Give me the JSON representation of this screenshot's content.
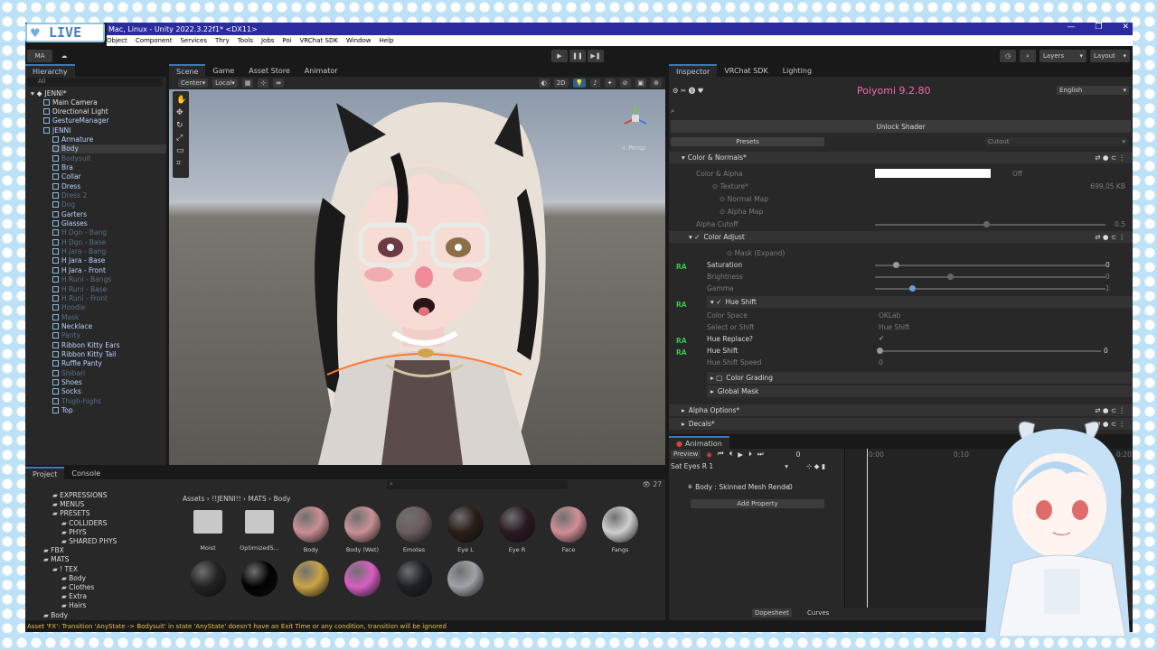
{
  "stream": {
    "badge": "LIVE"
  },
  "window": {
    "title": "Mac, Linux - Unity 2022.3.22f1* <DX11>",
    "controls": [
      "—",
      "❐",
      "✕"
    ]
  },
  "menu": [
    "Object",
    "Component",
    "Services",
    "Thry",
    "Tools",
    "Jobs",
    "Poi",
    "VRChat SDK",
    "Window",
    "Help"
  ],
  "toolbar": {
    "account": "MA",
    "layers": "Layers",
    "layout": "Layout"
  },
  "hierarchy": {
    "tab": "Hierarchy",
    "search": "All",
    "root": "JENNI*",
    "items": [
      {
        "label": "Main Camera",
        "style": "white",
        "indent": 1
      },
      {
        "label": "Directional Light",
        "style": "white",
        "indent": 1
      },
      {
        "label": "GestureManager",
        "style": "blue",
        "indent": 1
      },
      {
        "label": "JENNI",
        "style": "blue",
        "indent": 1
      },
      {
        "label": "Armature",
        "style": "blue",
        "indent": 2
      },
      {
        "label": "Body",
        "style": "sel",
        "indent": 2
      },
      {
        "label": "Bodysuit",
        "style": "dim",
        "indent": 2
      },
      {
        "label": "Bra",
        "style": "blue",
        "indent": 2
      },
      {
        "label": "Collar",
        "style": "blue",
        "indent": 2
      },
      {
        "label": "Dress",
        "style": "blue",
        "indent": 2
      },
      {
        "label": "Dress 2",
        "style": "dim",
        "indent": 2
      },
      {
        "label": "Dog",
        "style": "dim",
        "indent": 2
      },
      {
        "label": "Garters",
        "style": "blue",
        "indent": 2
      },
      {
        "label": "Glasses",
        "style": "blue",
        "indent": 2
      },
      {
        "label": "H Dgn - Bang",
        "style": "dim",
        "indent": 2
      },
      {
        "label": "H Dgn - Base",
        "style": "dim",
        "indent": 2
      },
      {
        "label": "H Jara - Bang",
        "style": "dim",
        "indent": 2
      },
      {
        "label": "H Jara - Base",
        "style": "blue",
        "indent": 2
      },
      {
        "label": "H Jara - Front",
        "style": "blue",
        "indent": 2
      },
      {
        "label": "H Runi - Bangs",
        "style": "dim",
        "indent": 2
      },
      {
        "label": "H Runi - Base",
        "style": "dim",
        "indent": 2
      },
      {
        "label": "H Runi - Front",
        "style": "dim",
        "indent": 2
      },
      {
        "label": "Hoodie",
        "style": "dim",
        "indent": 2
      },
      {
        "label": "Mask",
        "style": "dim",
        "indent": 2
      },
      {
        "label": "Necklace",
        "style": "blue",
        "indent": 2
      },
      {
        "label": "Panty",
        "style": "dim",
        "indent": 2
      },
      {
        "label": "Ribbon Kitty Ears",
        "style": "blue",
        "indent": 2
      },
      {
        "label": "Ribbon Kitty Tail",
        "style": "blue",
        "indent": 2
      },
      {
        "label": "Ruffle Panty",
        "style": "blue",
        "indent": 2
      },
      {
        "label": "Shibari",
        "style": "dim",
        "indent": 2
      },
      {
        "label": "Shoes",
        "style": "blue",
        "indent": 2
      },
      {
        "label": "Socks",
        "style": "blue",
        "indent": 2
      },
      {
        "label": "Thigh-highs",
        "style": "dim",
        "indent": 2
      },
      {
        "label": "Top",
        "style": "blue",
        "indent": 2
      }
    ]
  },
  "scene": {
    "tabs": [
      "Scene",
      "Game",
      "Asset Store",
      "Animator"
    ],
    "pivot": "Center",
    "space": "Local",
    "mode2d": "2D",
    "persp": "< Persp"
  },
  "inspector": {
    "tabs": [
      "Inspector",
      "VRChat SDK",
      "Lighting"
    ],
    "shader": "Poiyomi 9.2.80",
    "language": "English",
    "unlock": "Unlock Shader",
    "presets": "Presets",
    "cutout": "Cutout",
    "sections": {
      "color_normals": "Color & Normals*",
      "color_alpha": "Color & Alpha",
      "off": "Off",
      "texture": "Texture*",
      "texture_size": "699.05 KB",
      "normal_map": "Normal Map",
      "alpha_map": "Alpha Map",
      "alpha_cutoff": "Alpha Cutoff",
      "alpha_cutoff_val": "0.5",
      "color_adjust": "Color Adjust",
      "mask": "Mask (Expand)",
      "saturation": "Saturation",
      "saturation_val": "0",
      "brightness": "Brightness",
      "brightness_val": "0",
      "gamma": "Gamma",
      "gamma_val": "1",
      "hue_shift_header": "Hue Shift",
      "color_space": "Color Space",
      "color_space_val": "OKLab",
      "select_shift": "Select or Shift",
      "select_shift_val": "Hue Shift",
      "hue_replace": "Hue Replace?",
      "hue_shift": "Hue Shift",
      "hue_shift_val": "0",
      "hue_shift_speed": "Hue Shift Speed",
      "hue_shift_speed_val": "0",
      "color_grading": "Color Grading",
      "global_mask": "Global Mask",
      "alpha_options": "Alpha Options*",
      "decals": "Decals*",
      "ra": "RA"
    }
  },
  "animation": {
    "tab": "Animation",
    "preview": "Preview",
    "frame": "0",
    "clip": "Sat Eyes R 1",
    "property": "Body : Skinned Mesh Rende",
    "property_val": "0",
    "add": "Add Property",
    "dopesheet": "Dopesheet",
    "curves": "Curves",
    "time_0": "0:00",
    "time_1": "0:10",
    "time_2": "0:20"
  },
  "project": {
    "tabs": [
      "Project",
      "Console"
    ],
    "breadcrumb": [
      "Assets",
      "!!JENNI!!",
      "MATS",
      "Body"
    ],
    "tree": [
      {
        "label": "EXPRESSIONS",
        "indent": 2
      },
      {
        "label": "MENUS",
        "indent": 2
      },
      {
        "label": "PRESETS",
        "indent": 2
      },
      {
        "label": "COLLIDERS",
        "indent": 3
      },
      {
        "label": "PHYS",
        "indent": 3
      },
      {
        "label": "SHARED PHYS",
        "indent": 3
      },
      {
        "label": "FBX",
        "indent": 1
      },
      {
        "label": "MATS",
        "indent": 1
      },
      {
        "label": "! TEX",
        "indent": 2
      },
      {
        "label": "Body",
        "indent": 3
      },
      {
        "label": "Clothes",
        "indent": 3
      },
      {
        "label": "Extra",
        "indent": 3
      },
      {
        "label": "Hairs",
        "indent": 3
      },
      {
        "label": "Body",
        "indent": 1
      }
    ],
    "assets": [
      {
        "label": "Moist",
        "kind": "folder"
      },
      {
        "label": "OptimizedS...",
        "kind": "folder"
      },
      {
        "label": "Body",
        "color": "#c98f94"
      },
      {
        "label": "Body (Wet)",
        "color": "#c99096"
      },
      {
        "label": "Emotes",
        "color": "#6a5c5c"
      },
      {
        "label": "Eye L",
        "color": "#2a1e18"
      },
      {
        "label": "Eye R",
        "color": "#2a1a22"
      },
      {
        "label": "Face",
        "color": "#d08f96"
      },
      {
        "label": "Fangs",
        "color": "#cfcfcf"
      },
      {
        "label": "",
        "color": "#222222"
      },
      {
        "label": "",
        "color": "#020202"
      },
      {
        "label": "",
        "color": "#c9a445"
      },
      {
        "label": "",
        "color": "#d85fc2"
      },
      {
        "label": "",
        "color": "#1c2128"
      },
      {
        "label": "",
        "color": "#9ea3a8"
      }
    ],
    "count": "27"
  },
  "status": "Asset 'FX': Transition 'AnyState -> Bodysuit' in state 'AnyState' doesn't have an Exit Time or any condition, transition will be ignored"
}
